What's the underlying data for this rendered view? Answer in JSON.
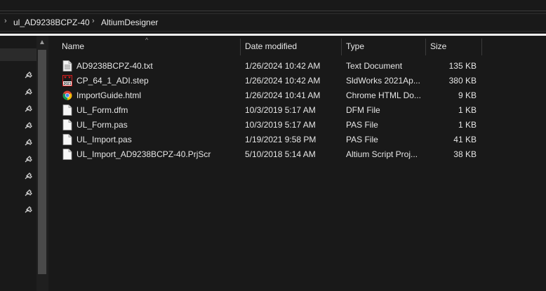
{
  "breadcrumb": {
    "items": [
      "ul_AD9238BCPZ-40",
      "AltiumDesigner"
    ],
    "separator": "›"
  },
  "columns": {
    "name": "Name",
    "date": "Date modified",
    "type": "Type",
    "size": "Size"
  },
  "files": [
    {
      "name": "AD9238BCPZ-40.txt",
      "date": "1/26/2024 10:42 AM",
      "type": "Text Document",
      "size": "135 KB",
      "icon": "text-file-icon"
    },
    {
      "name": "CP_64_1_ADI.step",
      "date": "1/26/2024 10:42 AM",
      "type": "SldWorks 2021Ap...",
      "size": "380 KB",
      "icon": "solidworks-file-icon"
    },
    {
      "name": "ImportGuide.html",
      "date": "1/26/2024 10:41 AM",
      "type": "Chrome HTML Do...",
      "size": "9 KB",
      "icon": "chrome-icon"
    },
    {
      "name": "UL_Form.dfm",
      "date": "10/3/2019 5:17 AM",
      "type": "DFM File",
      "size": "1 KB",
      "icon": "blank-file-icon"
    },
    {
      "name": "UL_Form.pas",
      "date": "10/3/2019 5:17 AM",
      "type": "PAS File",
      "size": "1 KB",
      "icon": "blank-file-icon"
    },
    {
      "name": "UL_Import.pas",
      "date": "1/19/2021 9:58 PM",
      "type": "PAS File",
      "size": "41 KB",
      "icon": "blank-file-icon"
    },
    {
      "name": "UL_Import_AD9238BCPZ-40.PrjScr",
      "date": "5/10/2018 5:14 AM",
      "type": "Altium Script Proj...",
      "size": "38 KB",
      "icon": "blank-file-icon"
    }
  ],
  "icon_text": {
    "solidworks_label": "2021"
  },
  "colors": {
    "background": "#191919",
    "text": "#e6e6e6",
    "chrome_red": "#db4437",
    "chrome_yellow": "#f4c20d",
    "chrome_green": "#0f9d58",
    "chrome_blue": "#4285f4",
    "solidworks_red": "#d71e1e"
  }
}
